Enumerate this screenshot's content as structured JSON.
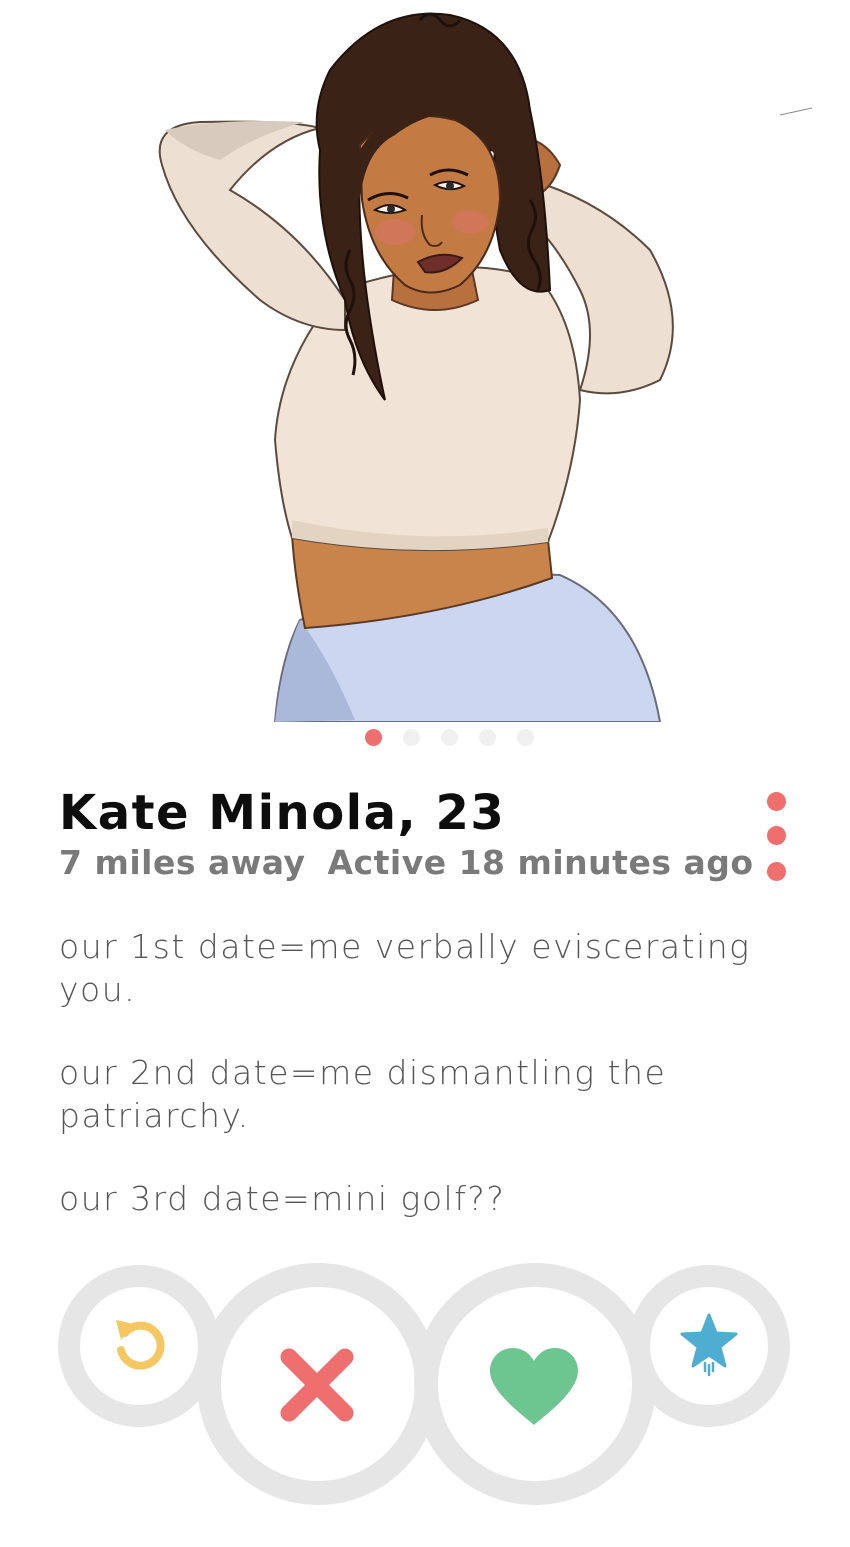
{
  "profile": {
    "name_age": "Kate Minola, 23",
    "distance": "7 miles away",
    "active": "Active 18 minutes ago",
    "bio": [
      "our 1st date=me verbally eviscerating you.",
      "our 2nd date=me dismantling the patriarchy.",
      "our 3rd date=mini golf??"
    ],
    "photo_index": 1,
    "photo_count": 5
  },
  "actions": [
    {
      "name": "rewind",
      "icon": "rewind-icon",
      "color": "#f5c763"
    },
    {
      "name": "nope",
      "icon": "close-icon",
      "color": "#ee6f6d"
    },
    {
      "name": "like",
      "icon": "heart-icon",
      "color": "#6dc58f"
    },
    {
      "name": "super-like",
      "icon": "star-icon",
      "color": "#4fadd1"
    }
  ],
  "colors": {
    "accent": "#ee6f6d",
    "dot_inactive": "#f0f0f0",
    "ring": "#e6e6e6"
  }
}
